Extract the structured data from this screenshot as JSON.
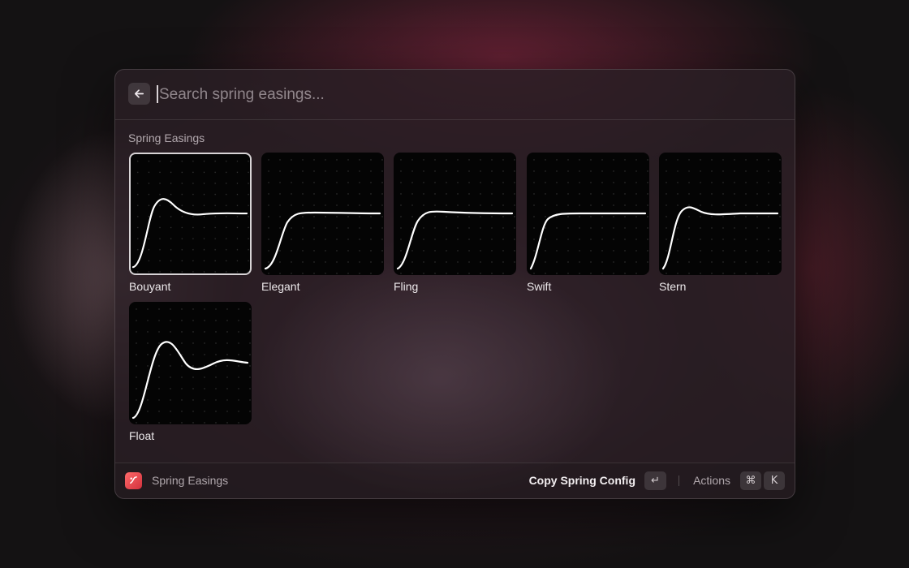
{
  "search": {
    "placeholder": "Search spring easings..."
  },
  "section": {
    "title": "Spring Easings"
  },
  "easings": [
    {
      "label": "Bouyant",
      "selected": true
    },
    {
      "label": "Elegant",
      "selected": false
    },
    {
      "label": "Fling",
      "selected": false
    },
    {
      "label": "Swift",
      "selected": false
    },
    {
      "label": "Stern",
      "selected": false
    },
    {
      "label": "Float",
      "selected": false
    }
  ],
  "footer": {
    "app_name": "Spring Easings",
    "primary_action": "Copy Spring Config",
    "enter_key": "↵",
    "actions_label": "Actions",
    "cmd_key": "⌘",
    "k_key": "K"
  },
  "colors": {
    "app_icon": "#e2434a",
    "curve": "#ffffff",
    "selected_border": "#d8d4d6"
  },
  "icons": {
    "back": "arrow-left-icon",
    "app": "spring-easings-app-icon"
  }
}
